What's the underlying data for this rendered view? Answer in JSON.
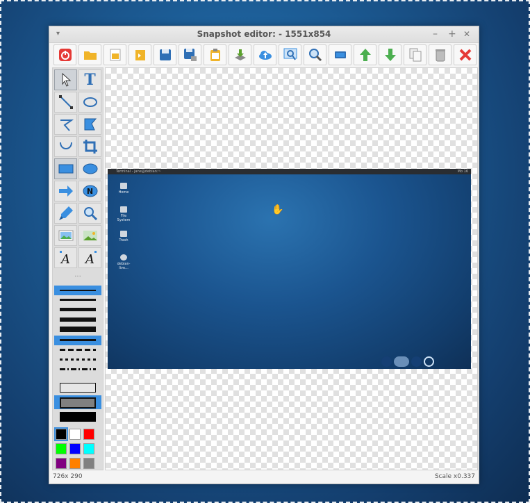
{
  "window": {
    "title": "Snapshot editor:  - 1551x854",
    "menu_glyph": "▾",
    "controls": {
      "minimize": "–",
      "maximize": "+",
      "close": "✕"
    }
  },
  "toolbar": {
    "buttons": [
      {
        "name": "quit-icon",
        "color": "#e53935"
      },
      {
        "name": "open-folder-icon",
        "color": "#f0b429"
      },
      {
        "name": "new-file-icon",
        "color": "#f0b429"
      },
      {
        "name": "import-icon",
        "color": "#f0b429"
      },
      {
        "name": "save-icon",
        "color": "#2f6fb5"
      },
      {
        "name": "save-as-icon",
        "color": "#2f6fb5"
      },
      {
        "name": "clipboard-icon",
        "color": "#f0b429"
      },
      {
        "name": "download-icon",
        "color": "#5aa02c"
      },
      {
        "name": "upload-cloud-icon",
        "color": "#3a8fe0"
      },
      {
        "name": "zoom-fit-icon",
        "color": "#3a8fe0"
      },
      {
        "name": "zoom-actual-icon",
        "color": "#3a8fe0"
      },
      {
        "name": "screen-icon",
        "color": "#2f6fb5"
      },
      {
        "name": "arrow-up-icon",
        "color": "#4caf50"
      },
      {
        "name": "arrow-down-icon",
        "color": "#4caf50"
      },
      {
        "name": "copy-icon",
        "color": "#9e9e9e"
      },
      {
        "name": "trash-icon",
        "color": "#9e9e9e"
      },
      {
        "name": "close-red-icon",
        "color": "#e53935"
      }
    ]
  },
  "tools": {
    "text_glyph": "T",
    "note_glyph": "N",
    "separator": "...",
    "colors": [
      "#000000",
      "#ffffff",
      "#ff0000",
      "#00ff00",
      "#0000ff",
      "#00ffff",
      "#800080",
      "#ff8000",
      "#808080"
    ]
  },
  "snapshot": {
    "panel_left": "Terminal - jane@debian:~",
    "panel_right": "Mo 16",
    "desktop_icons": [
      "Home",
      "File System",
      "Trash",
      "debian-live..."
    ]
  },
  "status": {
    "left": "726x 290",
    "right": "Scale x0.337"
  }
}
